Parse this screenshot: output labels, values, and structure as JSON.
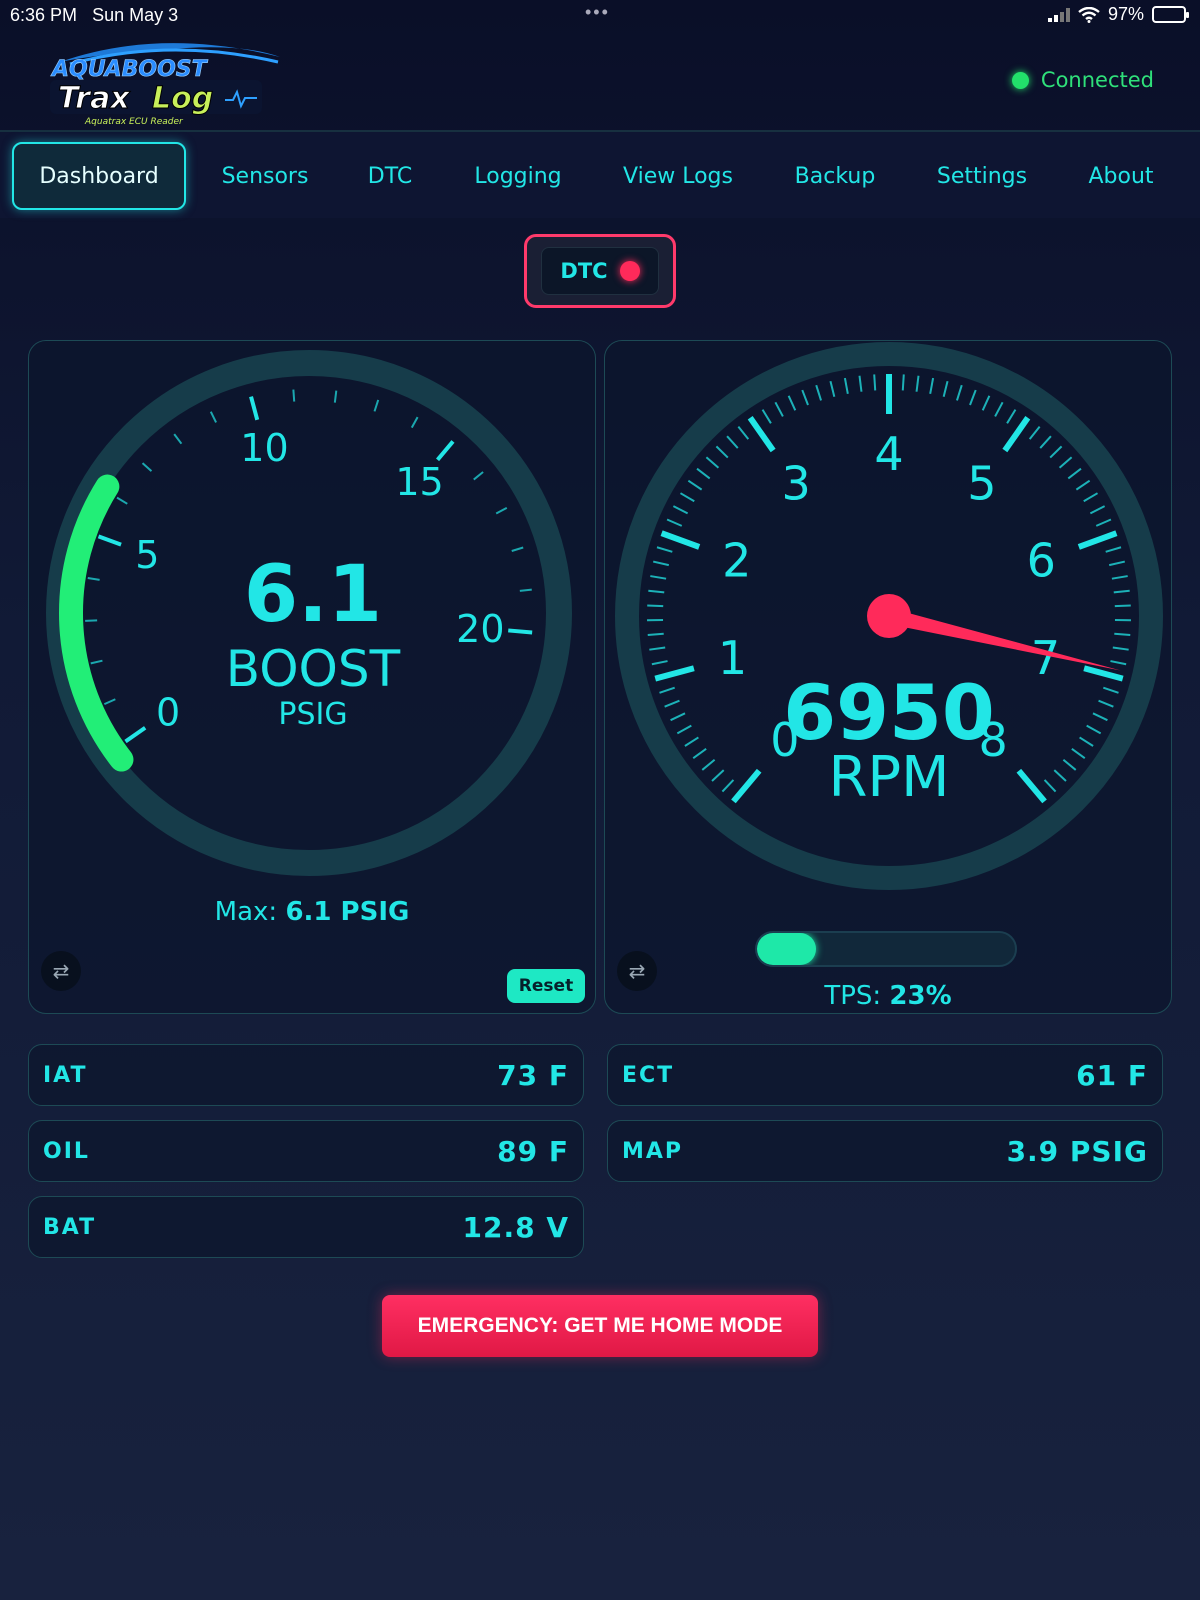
{
  "status_bar": {
    "time": "6:36 PM",
    "date": "Sun May 3",
    "battery": "97%",
    "battery_level": 0.97
  },
  "header": {
    "logo_top": "AQUABOOST",
    "logo_main_a": "Trax",
    "logo_main_b": "Log",
    "logo_sub": "Aquatrax ECU Reader",
    "connection": "Connected"
  },
  "nav": {
    "tabs": [
      {
        "label": "Dashboard",
        "active": true
      },
      {
        "label": "Sensors"
      },
      {
        "label": "DTC"
      },
      {
        "label": "Logging"
      },
      {
        "label": "View Logs"
      },
      {
        "label": "Backup"
      },
      {
        "label": "Settings"
      },
      {
        "label": "About"
      }
    ]
  },
  "dtc": {
    "label": "DTC"
  },
  "boost_gauge": {
    "value": "6.1",
    "value_num": 6.1,
    "label": "BOOST",
    "unit": "PSIG",
    "min": 0,
    "max": 20,
    "ticks": [
      "0",
      "5",
      "10",
      "15",
      "20"
    ],
    "max_label": "Max:",
    "max_value": "6.1 PSIG",
    "reset_label": "Reset",
    "arc_color": "#22ee77"
  },
  "rpm_gauge": {
    "value": "6950",
    "value_num": 6950,
    "label": "RPM",
    "min": 0,
    "max": 8000,
    "ticks": [
      "0",
      "1",
      "2",
      "3",
      "4",
      "5",
      "6",
      "7",
      "8"
    ],
    "needle_color": "#ff2a5a",
    "tps_label": "TPS:",
    "tps_value": "23%",
    "tps_fraction": 0.23
  },
  "sensors": {
    "iat": {
      "label": "IAT",
      "value": "73 F"
    },
    "ect": {
      "label": "ECT",
      "value": "61 F"
    },
    "oil": {
      "label": "OIL",
      "value": "89 F"
    },
    "map": {
      "label": "MAP",
      "value": "3.9 PSIG"
    },
    "bat": {
      "label": "BAT",
      "value": "12.8 V"
    }
  },
  "emergency": {
    "label": "EMERGENCY: GET ME HOME MODE"
  },
  "colors": {
    "accent": "#22e6e6",
    "alert": "#ff2a5a",
    "ok": "#22e06a"
  }
}
